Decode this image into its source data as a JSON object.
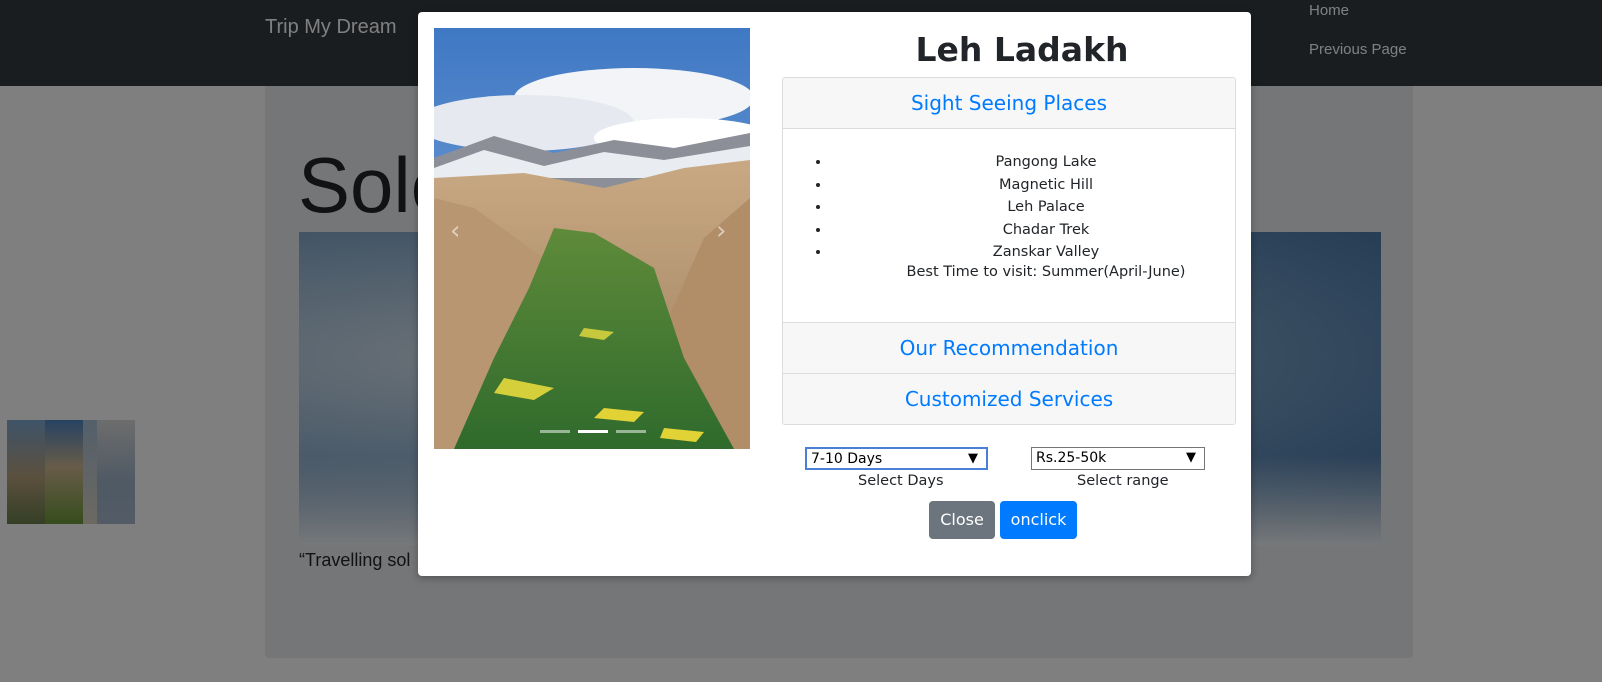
{
  "navbar": {
    "brand": "Trip My Dream",
    "links": [
      "Home",
      "Previous Page"
    ]
  },
  "page": {
    "title_fragment": "Solo",
    "quote_fragment": "“Travelling sol"
  },
  "modal": {
    "title": "Leh Ladakh",
    "carousel": {
      "indicators": 3,
      "active_indicator": 2,
      "prev_icon": "‹",
      "next_icon": "›"
    },
    "accordion": {
      "section1": {
        "header": "Sight Seeing Places",
        "places": [
          "Pangong Lake",
          "Magnetic Hill",
          "Leh Palace",
          "Chadar Trek",
          "Zanskar Valley"
        ],
        "best_time": "Best Time to visit: Summer(April-June)"
      },
      "section2": {
        "header": "Our Recommendation"
      },
      "section3": {
        "header": "Customized Services"
      }
    },
    "days_select": {
      "value": "7-10 Days",
      "label": "Select Days"
    },
    "range_select": {
      "value": "Rs.25-50k",
      "label": "Select range"
    },
    "buttons": {
      "close": "Close",
      "submit": "onclick"
    },
    "colors": {
      "link": "#007bff",
      "secondary": "#6c757d",
      "primary": "#007bff"
    }
  }
}
